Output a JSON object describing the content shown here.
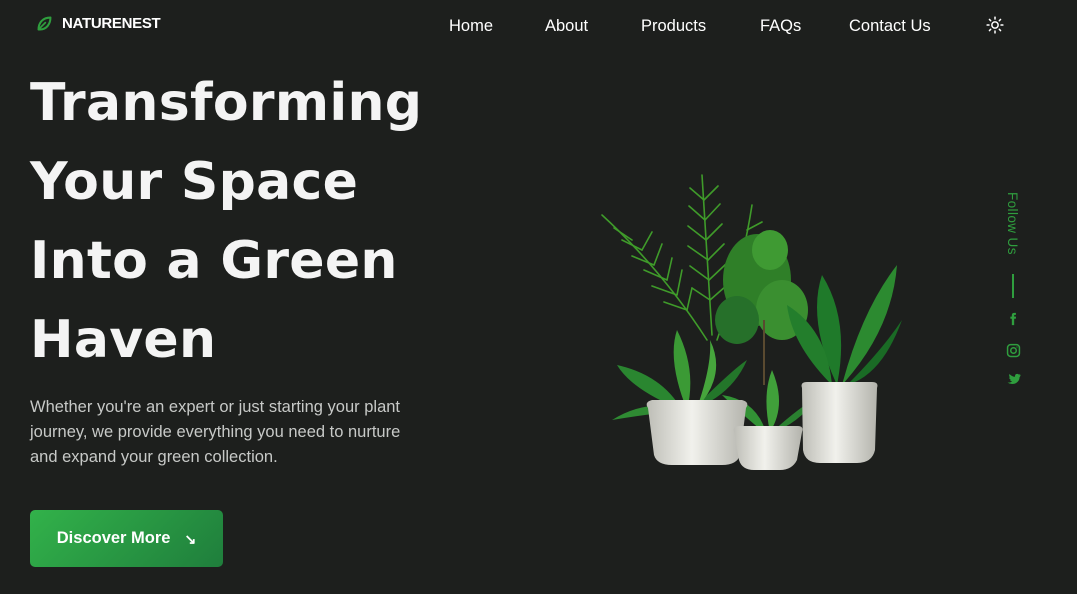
{
  "brand": {
    "name": "NATURENEST",
    "icon": "leaf-icon"
  },
  "nav": {
    "items": [
      {
        "label": "Home"
      },
      {
        "label": "About"
      },
      {
        "label": "Products"
      },
      {
        "label": "FAQs"
      },
      {
        "label": "Contact Us"
      }
    ],
    "theme_toggle_icon": "sun-icon"
  },
  "hero": {
    "title_lines": [
      "Transforming",
      "Your Space",
      "Into a Green",
      "Haven"
    ],
    "description": "Whether you're an expert or just starting your plant journey, we provide everything you need to nurture and expand your green collection.",
    "cta_label": "Discover More",
    "cta_icon": "arrow-down-right-icon",
    "image_icon": "potted-plants-illustration"
  },
  "follow": {
    "label": "Follow Us",
    "socials": [
      {
        "icon": "facebook-icon"
      },
      {
        "icon": "instagram-icon"
      },
      {
        "icon": "twitter-icon"
      }
    ]
  },
  "colors": {
    "background": "#1d1f1d",
    "accent": "#2f9e3e",
    "button_start": "#32b24a",
    "button_end": "#1f7e3c",
    "text": "#f4f4f4",
    "muted_text": "#c7c9c7"
  }
}
